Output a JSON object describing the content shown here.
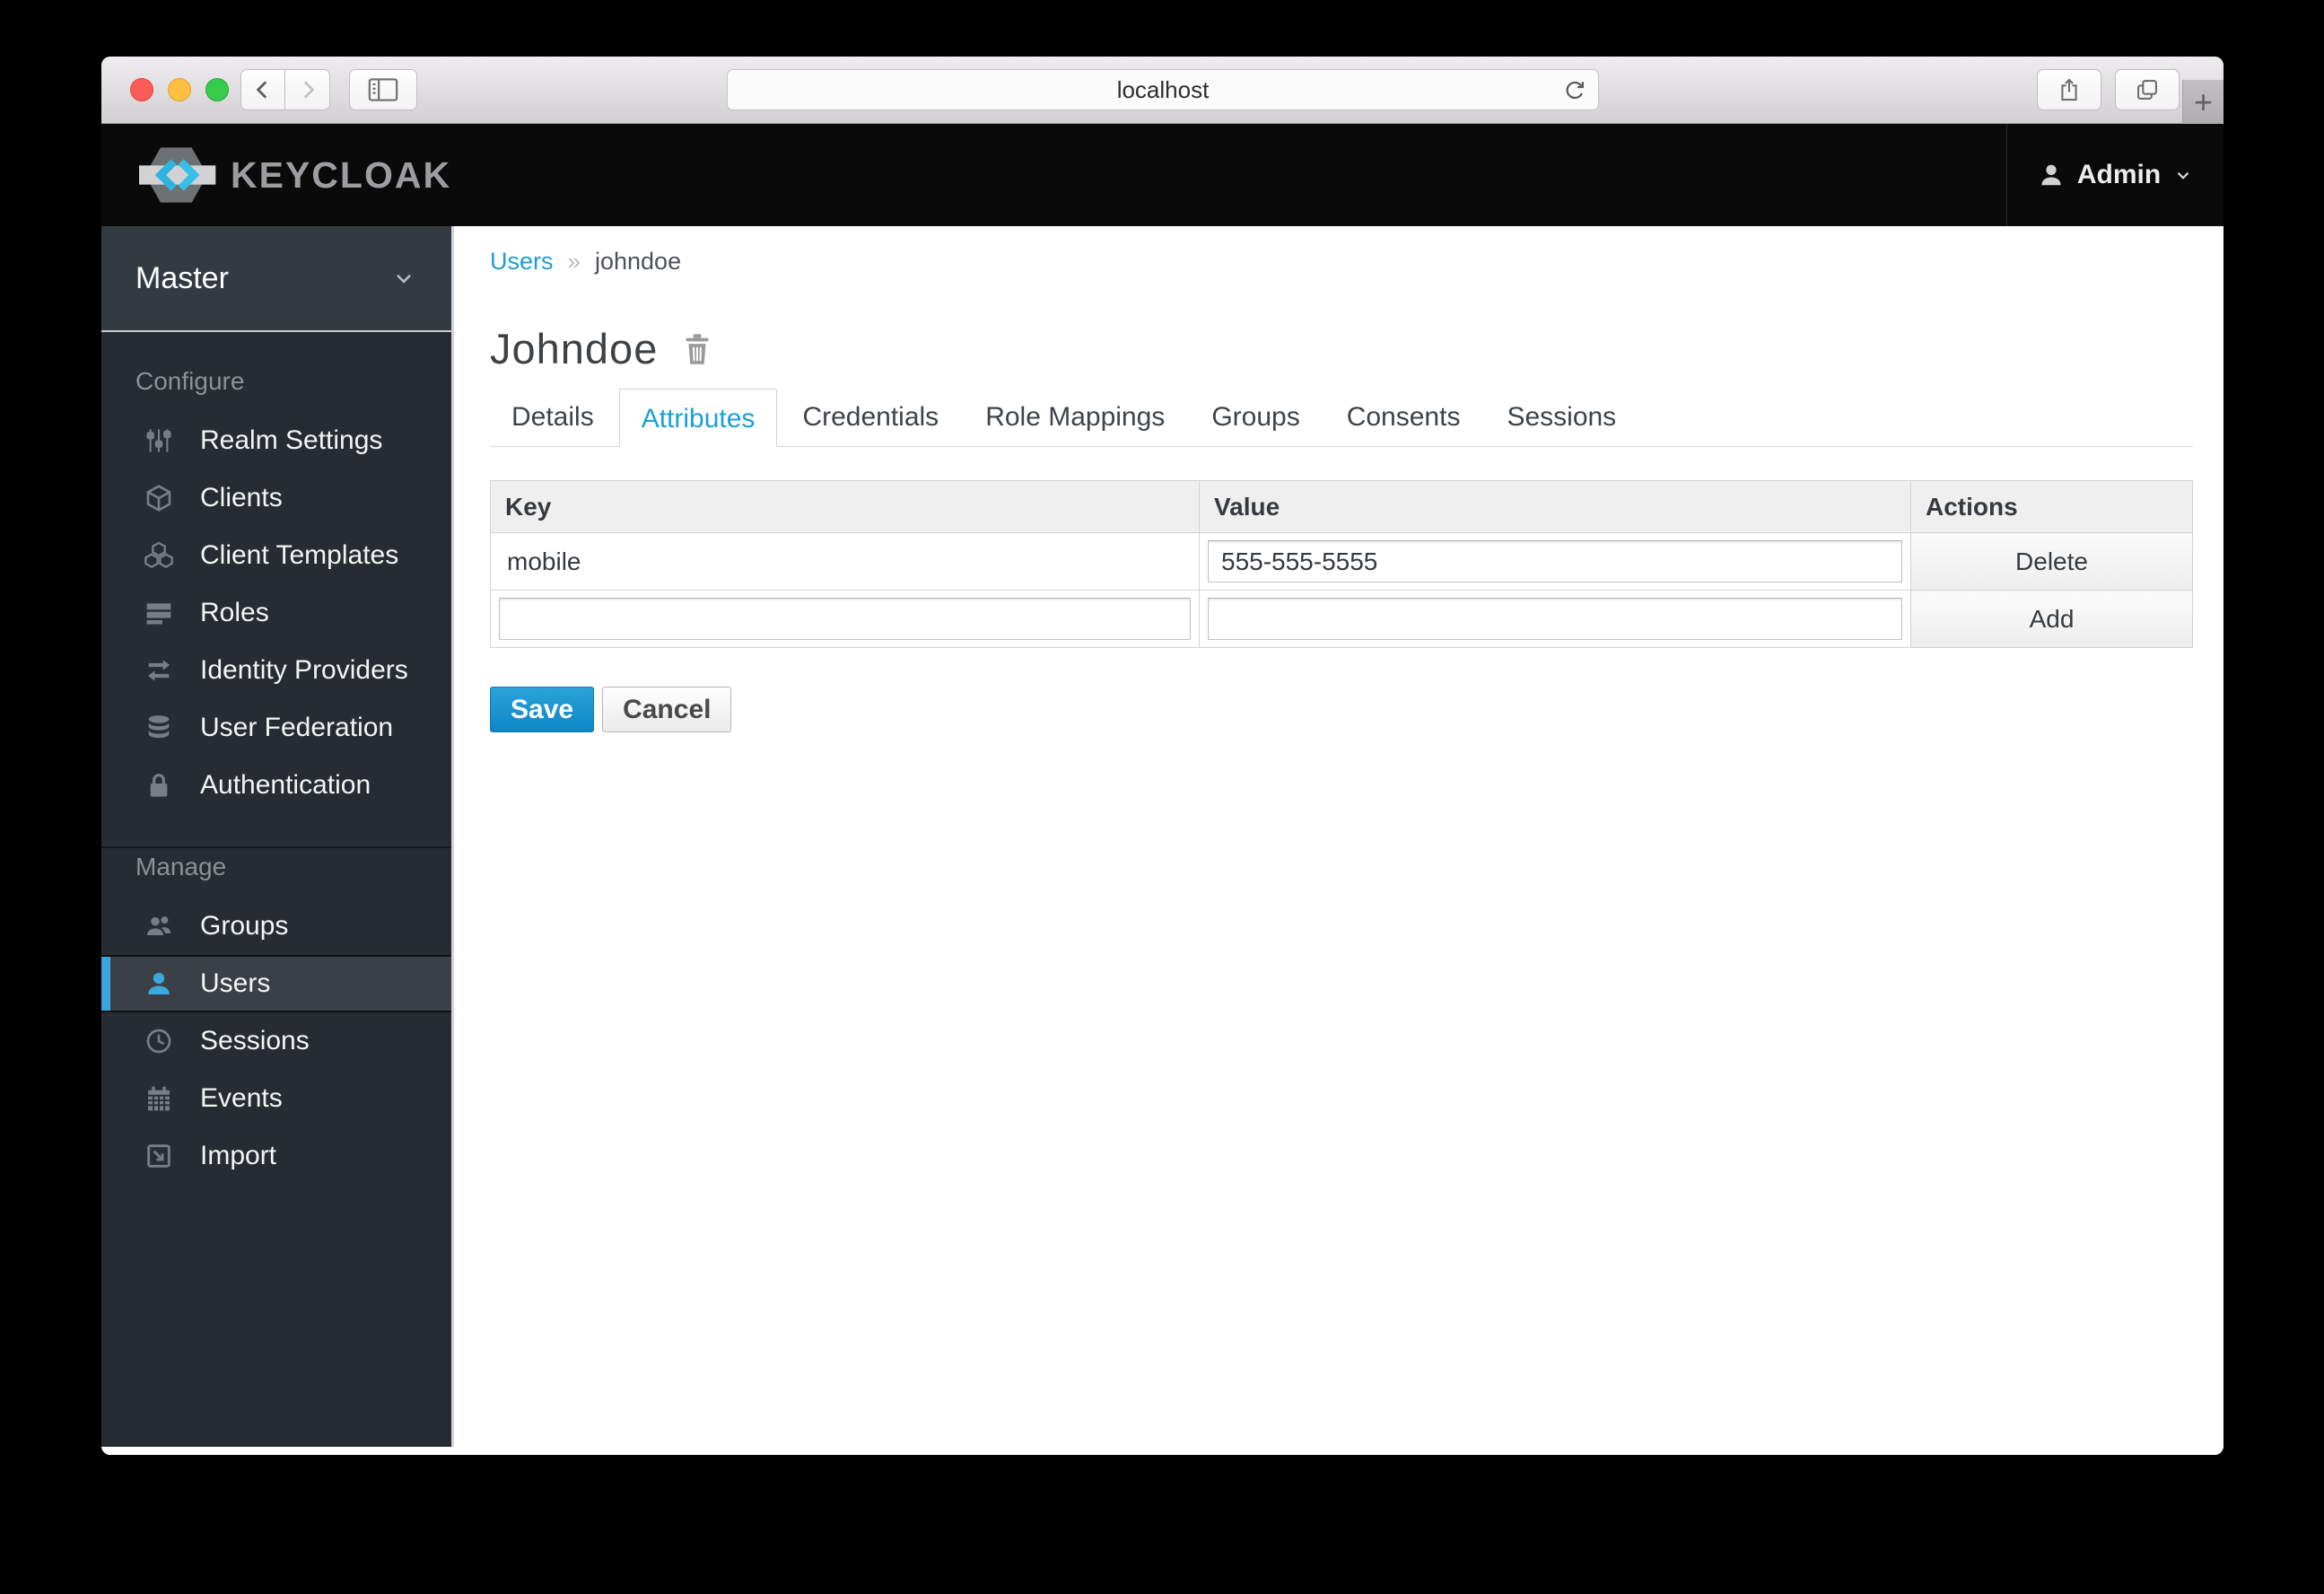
{
  "browser": {
    "url": "localhost",
    "new_tab_glyph": "+",
    "icons": [
      "close",
      "minimize",
      "zoom",
      "back-icon",
      "forward-icon",
      "sidebar-toggle-icon",
      "reload-icon",
      "share-icon",
      "tabs-overview-icon",
      "new-tab-icon"
    ]
  },
  "kc_header": {
    "brand": "KEYCLOAK",
    "user_menu": {
      "label": "Admin",
      "icon": "user-icon",
      "chevron": "chevron-down-icon"
    }
  },
  "sidebar": {
    "realm_selector": {
      "label": "Master",
      "icon": "chevron-down-icon"
    },
    "sections": [
      {
        "label": "Configure",
        "items": [
          {
            "label": "Realm Settings",
            "icon": "sliders-icon"
          },
          {
            "label": "Clients",
            "icon": "cube-icon"
          },
          {
            "label": "Client Templates",
            "icon": "cubes-icon"
          },
          {
            "label": "Roles",
            "icon": "list-icon"
          },
          {
            "label": "Identity Providers",
            "icon": "exchange-icon"
          },
          {
            "label": "User Federation",
            "icon": "database-icon"
          },
          {
            "label": "Authentication",
            "icon": "lock-icon"
          }
        ]
      },
      {
        "label": "Manage",
        "items": [
          {
            "label": "Groups",
            "icon": "group-icon"
          },
          {
            "label": "Users",
            "icon": "user-icon",
            "active": true
          },
          {
            "label": "Sessions",
            "icon": "clock-icon"
          },
          {
            "label": "Events",
            "icon": "calendar-icon"
          },
          {
            "label": "Import",
            "icon": "import-icon"
          }
        ]
      }
    ]
  },
  "main": {
    "breadcrumb": {
      "parent": "Users",
      "separator": "»",
      "current": "johndoe"
    },
    "page_title": "Johndoe",
    "title_icon": "trash-icon",
    "tabs": [
      {
        "label": "Details"
      },
      {
        "label": "Attributes",
        "active": true
      },
      {
        "label": "Credentials"
      },
      {
        "label": "Role Mappings"
      },
      {
        "label": "Groups"
      },
      {
        "label": "Consents"
      },
      {
        "label": "Sessions"
      }
    ],
    "attributes_table": {
      "headers": {
        "key": "Key",
        "value": "Value",
        "actions": "Actions"
      },
      "rows": [
        {
          "key": "mobile",
          "value": "555-555-5555",
          "action": "Delete"
        },
        {
          "key": "",
          "value": "",
          "action": "Add"
        }
      ]
    },
    "form_buttons": {
      "save": "Save",
      "cancel": "Cancel"
    }
  },
  "colors": {
    "accent_blue": "#1ba0d8",
    "active_nav_bar": "#39a5dc",
    "save_button": "#0c87c6",
    "header_bg": "#0a0a0a",
    "sidebar_bg": "#272c32"
  }
}
